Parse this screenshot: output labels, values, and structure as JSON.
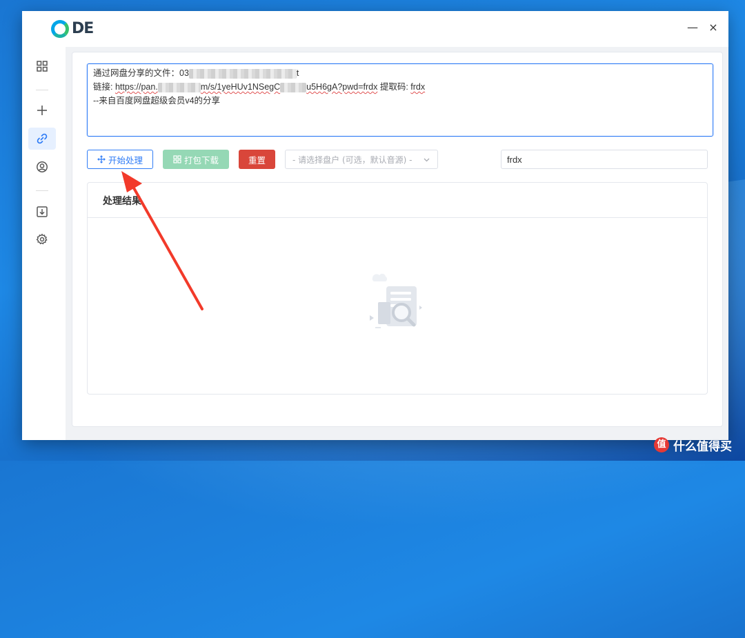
{
  "app": {
    "logo_text": "DE",
    "window_controls": {
      "minimize": "—",
      "close": "×"
    }
  },
  "sidebar": {
    "items": [
      {
        "name": "dashboard",
        "icon": "grid-icon",
        "active": false
      },
      {
        "name": "add",
        "icon": "plus-icon",
        "active": false
      },
      {
        "name": "link",
        "icon": "link-icon",
        "active": true
      },
      {
        "name": "account",
        "icon": "user-circle-icon",
        "active": false
      },
      {
        "name": "downloads",
        "icon": "download-box-icon",
        "active": false
      },
      {
        "name": "settings",
        "icon": "gear-icon",
        "active": false
      }
    ]
  },
  "share_input": {
    "line1_prefix": "通过网盘分享的文件：03",
    "line1_suffix": "t",
    "line2_label": "链接: ",
    "line2_url_start": "https://pan.",
    "line2_url_mid": "m/s/1yeHUv1NSegC",
    "line2_url_end": "u5H6gA?pwd=frdx",
    "line2_code_label": " 提取码: ",
    "line2_code": "frdx",
    "line3": "--来自百度网盘超级会员v4的分享"
  },
  "toolbar": {
    "start_label": "开始处理",
    "pack_label": "打包下载",
    "reset_label": "重置",
    "drive_placeholder": "- 请选择盘户 (可选，默认音源) -",
    "code_value": "frdx"
  },
  "results": {
    "title": "处理结果"
  },
  "watermark": {
    "badge": "值",
    "text": "什么值得买"
  },
  "colors": {
    "primary": "#2f7cf6",
    "success_light": "#95d8b5",
    "danger": "#d9463a",
    "annotation_arrow": "#f23a2a"
  }
}
